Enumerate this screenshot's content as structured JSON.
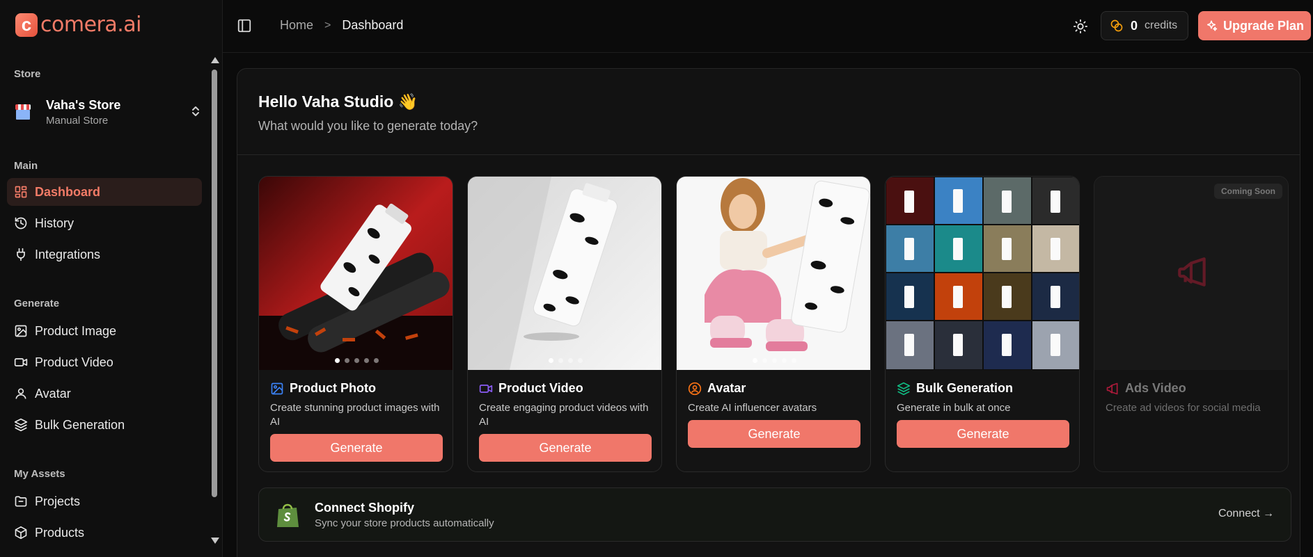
{
  "brand": {
    "mark": "c",
    "name": "comera.ai"
  },
  "sidebar": {
    "store_section": "Store",
    "store": {
      "name": "Vaha's Store",
      "type": "Manual Store"
    },
    "main_section": "Main",
    "main_items": [
      {
        "label": "Dashboard",
        "icon": "dashboard-icon",
        "active": true
      },
      {
        "label": "History",
        "icon": "history-icon"
      },
      {
        "label": "Integrations",
        "icon": "plug-icon"
      }
    ],
    "generate_section": "Generate",
    "generate_items": [
      {
        "label": "Product Image",
        "icon": "image-icon"
      },
      {
        "label": "Product Video",
        "icon": "video-icon"
      },
      {
        "label": "Avatar",
        "icon": "user-icon"
      },
      {
        "label": "Bulk Generation",
        "icon": "layers-icon"
      }
    ],
    "assets_section": "My Assets",
    "asset_items": [
      {
        "label": "Projects",
        "icon": "folder-icon"
      },
      {
        "label": "Products",
        "icon": "box-icon"
      }
    ]
  },
  "topbar": {
    "breadcrumb": {
      "home": "Home",
      "separator": ">",
      "current": "Dashboard"
    },
    "credits": {
      "value": "0",
      "label": "credits"
    },
    "upgrade_label": "Upgrade Plan"
  },
  "hero": {
    "greeting": "Hello Vaha Studio",
    "emoji": "👋",
    "subtitle": "What would you like to generate today?"
  },
  "cards": [
    {
      "title": "Product Photo",
      "icon": "image-icon",
      "description": "Create stunning product images with AI",
      "button": "Generate",
      "accent": "#3b82f6"
    },
    {
      "title": "Product Video",
      "icon": "video-icon",
      "description": "Create engaging product videos with AI",
      "button": "Generate",
      "accent": "#8b5cf6"
    },
    {
      "title": "Avatar",
      "icon": "user-circle-icon",
      "description": "Create AI influencer avatars",
      "button": "Generate",
      "accent": "#f97316"
    },
    {
      "title": "Bulk Generation",
      "icon": "layers-icon",
      "description": "Generate in bulk at once",
      "button": "Generate",
      "accent": "#10b981"
    },
    {
      "title": "Ads Video",
      "icon": "megaphone-icon",
      "description": "Create ad videos for social media",
      "badge": "Coming Soon",
      "accent": "#e11d48"
    }
  ],
  "shopify": {
    "title": "Connect Shopify",
    "subtitle": "Sync your store products automatically",
    "action": "Connect →"
  },
  "colors": {
    "accent": "#f0776a",
    "background": "#0b0b0b",
    "panel": "#121212"
  }
}
